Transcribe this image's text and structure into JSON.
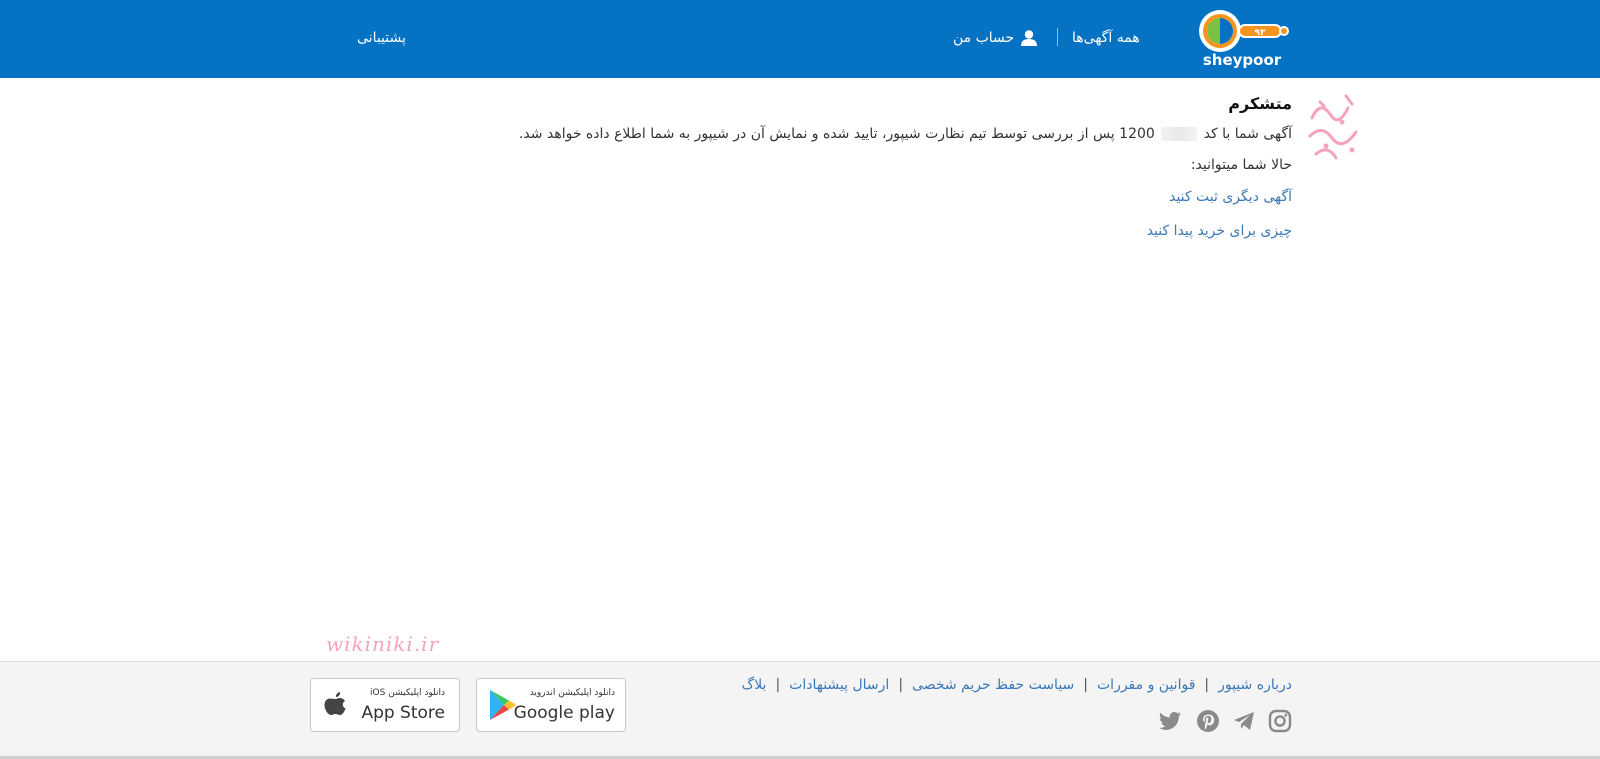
{
  "header": {
    "brand": "sheypoor",
    "nav_all_ads": "همه آگهی‌ها",
    "nav_account": "حساب من",
    "nav_support": "پشتیبانی",
    "bg_color": "#0572c4"
  },
  "main": {
    "title": "متشکرم",
    "message_prefix": "آگهی شما با کد",
    "message_code_visible": "1200",
    "message_suffix": "پس از بررسی توسط تیم نظارت شیپور، تایید شده و نمایش آن در شیپور به شما اطلاع داده خواهد شد.",
    "now_you_can": "حالا شما میتوانید:",
    "link_post_ad": "آگهی دیگری ثبت کنید",
    "link_find": "چیزی برای خرید پیدا کنید",
    "link_color": "#3a78b8"
  },
  "watermark": {
    "site": "wikiniki.ir"
  },
  "footer": {
    "links": [
      "درباره شیپور",
      "قوانین و مقررات",
      "سیاست حفظ حریم شخصی",
      "ارسال پیشنهادات",
      "بلاگ"
    ],
    "social_icons": [
      "instagram-icon",
      "telegram-icon",
      "pinterest-icon",
      "twitter-icon"
    ],
    "google_play_small": "دانلود اپلیکیشن اندروید",
    "google_play_big": "Google play",
    "app_store_small": "دانلود اپلیکیشن iOS",
    "app_store_big": "App Store",
    "bg_color": "#f4f4f4"
  }
}
